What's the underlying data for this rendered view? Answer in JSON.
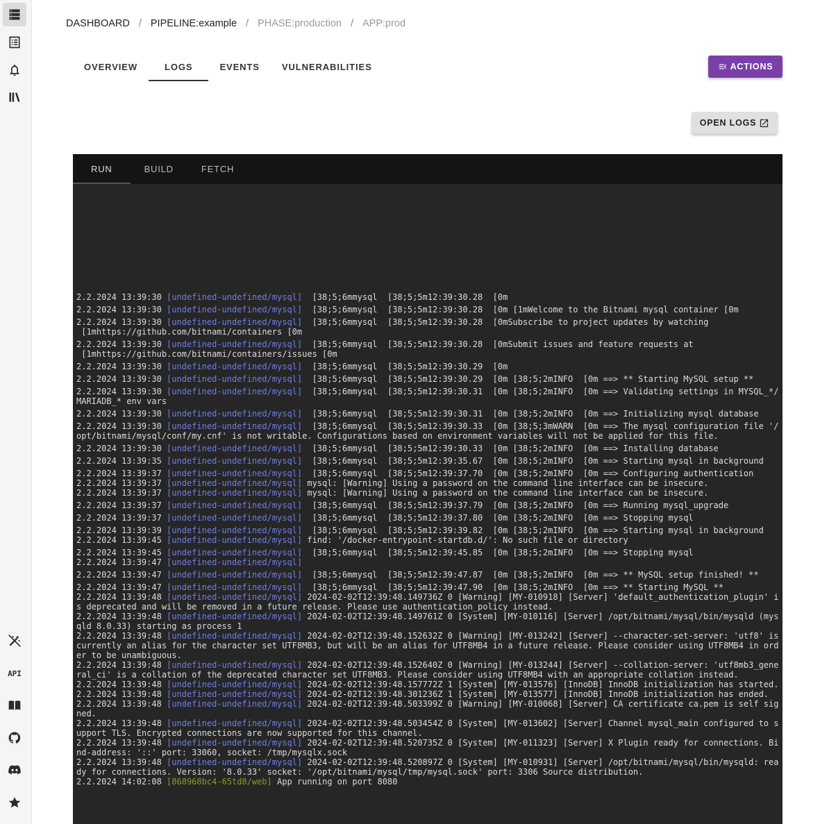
{
  "breadcrumb": {
    "items": [
      "DASHBOARD",
      "PIPELINE:example",
      "PHASE:production",
      "APP:prod"
    ],
    "separator": "/"
  },
  "tabs": [
    {
      "label": "OVERVIEW"
    },
    {
      "label": "LOGS"
    },
    {
      "label": "EVENTS"
    },
    {
      "label": "VULNERABILITIES"
    }
  ],
  "active_tab": "LOGS",
  "actions_label": "ACTIONS",
  "open_logs_label": "OPEN LOGS",
  "log_tabs": [
    {
      "label": "RUN"
    },
    {
      "label": "BUILD"
    },
    {
      "label": "FETCH"
    }
  ],
  "sidebar": {
    "top_icons": [
      "server-icon",
      "list-icon",
      "bell-icon",
      "library-icon"
    ],
    "bottom_icons": [
      "magic-icon",
      "api-icon",
      "book-icon",
      "github-icon",
      "discord-icon",
      "star-icon"
    ],
    "api_text": "API"
  },
  "colors": {
    "accent": "#7b3fa8",
    "log_bg": "#262626",
    "log_source": "#6f7fe6",
    "log_source_web": "#8a9a2a"
  },
  "logs": [
    {
      "ts": "2.2.2024 13:39:30",
      "src": "[undefined-undefined/mysql]",
      "msg": " [38;5;6mmysql  [38;5;5m12:39:30.28  [0m"
    },
    {
      "ts": "2.2.2024 13:39:30",
      "src": "[undefined-undefined/mysql]",
      "msg": " [38;5;6mmysql  [38;5;5m12:39:30.28  [0m [1mWelcome to the Bitnami mysql container [0m"
    },
    {
      "ts": "2.2.2024 13:39:30",
      "src": "[undefined-undefined/mysql]",
      "msg": " [38;5;6mmysql  [38;5;5m12:39:30.28  [0mSubscribe to project updates by watching\n [1mhttps://github.com/bitnami/containers [0m"
    },
    {
      "ts": "2.2.2024 13:39:30",
      "src": "[undefined-undefined/mysql]",
      "msg": " [38;5;6mmysql  [38;5;5m12:39:30.28  [0mSubmit issues and feature requests at\n [1mhttps://github.com/bitnami/containers/issues [0m"
    },
    {
      "ts": "2.2.2024 13:39:30",
      "src": "[undefined-undefined/mysql]",
      "msg": " [38;5;6mmysql  [38;5;5m12:39:30.29  [0m"
    },
    {
      "ts": "2.2.2024 13:39:30",
      "src": "[undefined-undefined/mysql]",
      "msg": " [38;5;6mmysql  [38;5;5m12:39:30.29  [0m [38;5;2mINFO  [0m ==> ** Starting MySQL setup **"
    },
    {
      "ts": "2.2.2024 13:39:30",
      "src": "[undefined-undefined/mysql]",
      "msg": " [38;5;6mmysql  [38;5;5m12:39:30.31  [0m [38;5;2mINFO  [0m ==> Validating settings in MYSQL_*/MARIADB_* env vars"
    },
    {
      "ts": "2.2.2024 13:39:30",
      "src": "[undefined-undefined/mysql]",
      "msg": " [38;5;6mmysql  [38;5;5m12:39:30.31  [0m [38;5;2mINFO  [0m ==> Initializing mysql database"
    },
    {
      "ts": "2.2.2024 13:39:30",
      "src": "[undefined-undefined/mysql]",
      "msg": " [38;5;6mmysql  [38;5;5m12:39:30.33  [0m [38;5;3mWARN  [0m ==> The mysql configuration file '/opt/bitnami/mysql/conf/my.cnf' is not writable. Configurations based on environment variables will not be applied for this file."
    },
    {
      "ts": "2.2.2024 13:39:30",
      "src": "[undefined-undefined/mysql]",
      "msg": " [38;5;6mmysql  [38;5;5m12:39:30.33  [0m [38;5;2mINFO  [0m ==> Installing database"
    },
    {
      "ts": "2.2.2024 13:39:35",
      "src": "[undefined-undefined/mysql]",
      "msg": " [38;5;6mmysql  [38;5;5m12:39:35.67  [0m [38;5;2mINFO  [0m ==> Starting mysql in background"
    },
    {
      "ts": "2.2.2024 13:39:37",
      "src": "[undefined-undefined/mysql]",
      "msg": " [38;5;6mmysql  [38;5;5m12:39:37.70  [0m [38;5;2mINFO  [0m ==> Configuring authentication"
    },
    {
      "ts": "2.2.2024 13:39:37",
      "src": "[undefined-undefined/mysql]",
      "msg": "mysql: [Warning] Using a password on the command line interface can be insecure."
    },
    {
      "ts": "2.2.2024 13:39:37",
      "src": "[undefined-undefined/mysql]",
      "msg": "mysql: [Warning] Using a password on the command line interface can be insecure."
    },
    {
      "ts": "2.2.2024 13:39:37",
      "src": "[undefined-undefined/mysql]",
      "msg": " [38;5;6mmysql  [38;5;5m12:39:37.79  [0m [38;5;2mINFO  [0m ==> Running mysql_upgrade"
    },
    {
      "ts": "2.2.2024 13:39:37",
      "src": "[undefined-undefined/mysql]",
      "msg": " [38;5;6mmysql  [38;5;5m12:39:37.80  [0m [38;5;2mINFO  [0m ==> Stopping mysql"
    },
    {
      "ts": "2.2.2024 13:39:39",
      "src": "[undefined-undefined/mysql]",
      "msg": " [38;5;6mmysql  [38;5;5m12:39:39.82  [0m [38;5;2mINFO  [0m ==> Starting mysql in background"
    },
    {
      "ts": "2.2.2024 13:39:45",
      "src": "[undefined-undefined/mysql]",
      "msg": "find: '/docker-entrypoint-startdb.d/': No such file or directory"
    },
    {
      "ts": "2.2.2024 13:39:45",
      "src": "[undefined-undefined/mysql]",
      "msg": " [38;5;6mmysql  [38;5;5m12:39:45.85  [0m [38;5;2mINFO  [0m ==> Stopping mysql"
    },
    {
      "ts": "2.2.2024 13:39:47",
      "src": "[undefined-undefined/mysql]",
      "msg": ""
    },
    {
      "ts": "2.2.2024 13:39:47",
      "src": "[undefined-undefined/mysql]",
      "msg": " [38;5;6mmysql  [38;5;5m12:39:47.87  [0m [38;5;2mINFO  [0m ==> ** MySQL setup finished! **"
    },
    {
      "ts": "2.2.2024 13:39:47",
      "src": "[undefined-undefined/mysql]",
      "msg": " [38;5;6mmysql  [38;5;5m12:39:47.90  [0m [38;5;2mINFO  [0m ==> ** Starting MySQL **"
    },
    {
      "ts": "2.2.2024 13:39:48",
      "src": "[undefined-undefined/mysql]",
      "msg": "2024-02-02T12:39:48.149736Z 0 [Warning] [MY-010918] [Server] 'default_authentication_plugin' is deprecated and will be removed in a future release. Please use authentication_policy instead."
    },
    {
      "ts": "2.2.2024 13:39:48",
      "src": "[undefined-undefined/mysql]",
      "msg": "2024-02-02T12:39:48.149761Z 0 [System] [MY-010116] [Server] /opt/bitnami/mysql/bin/mysqld (mysqld 8.0.33) starting as process 1"
    },
    {
      "ts": "2.2.2024 13:39:48",
      "src": "[undefined-undefined/mysql]",
      "msg": "2024-02-02T12:39:48.152632Z 0 [Warning] [MY-013242] [Server] --character-set-server: 'utf8' is currently an alias for the character set UTF8MB3, but will be an alias for UTF8MB4 in a future release. Please consider using UTF8MB4 in order to be unambiguous."
    },
    {
      "ts": "2.2.2024 13:39:48",
      "src": "[undefined-undefined/mysql]",
      "msg": "2024-02-02T12:39:48.152640Z 0 [Warning] [MY-013244] [Server] --collation-server: 'utf8mb3_general_ci' is a collation of the deprecated character set UTF8MB3. Please consider using UTF8MB4 with an appropriate collation instead."
    },
    {
      "ts": "2.2.2024 13:39:48",
      "src": "[undefined-undefined/mysql]",
      "msg": "2024-02-02T12:39:48.157772Z 1 [System] [MY-013576] [InnoDB] InnoDB initialization has started."
    },
    {
      "ts": "2.2.2024 13:39:48",
      "src": "[undefined-undefined/mysql]",
      "msg": "2024-02-02T12:39:48.301236Z 1 [System] [MY-013577] [InnoDB] InnoDB initialization has ended."
    },
    {
      "ts": "2.2.2024 13:39:48",
      "src": "[undefined-undefined/mysql]",
      "msg": "2024-02-02T12:39:48.503399Z 0 [Warning] [MY-010068] [Server] CA certificate ca.pem is self signed."
    },
    {
      "ts": "2.2.2024 13:39:48",
      "src": "[undefined-undefined/mysql]",
      "msg": "2024-02-02T12:39:48.503454Z 0 [System] [MY-013602] [Server] Channel mysql_main configured to support TLS. Encrypted connections are now supported for this channel."
    },
    {
      "ts": "2.2.2024 13:39:48",
      "src": "[undefined-undefined/mysql]",
      "msg": "2024-02-02T12:39:48.520735Z 0 [System] [MY-011323] [Server] X Plugin ready for connections. Bind-address: '::' port: 33060, socket: /tmp/mysqlx.sock"
    },
    {
      "ts": "2.2.2024 13:39:48",
      "src": "[undefined-undefined/mysql]",
      "msg": "2024-02-02T12:39:48.520897Z 0 [System] [MY-010931] [Server] /opt/bitnami/mysql/bin/mysqld: ready for connections. Version: '8.0.33' socket: '/opt/bitnami/mysql/tmp/mysql.sock' port: 3306 Source distribution."
    },
    {
      "ts": "2.2.2024 14:02:08",
      "src": "[868968bc4-65td8/web]",
      "msg": "App running on port 8080",
      "web": true
    }
  ]
}
